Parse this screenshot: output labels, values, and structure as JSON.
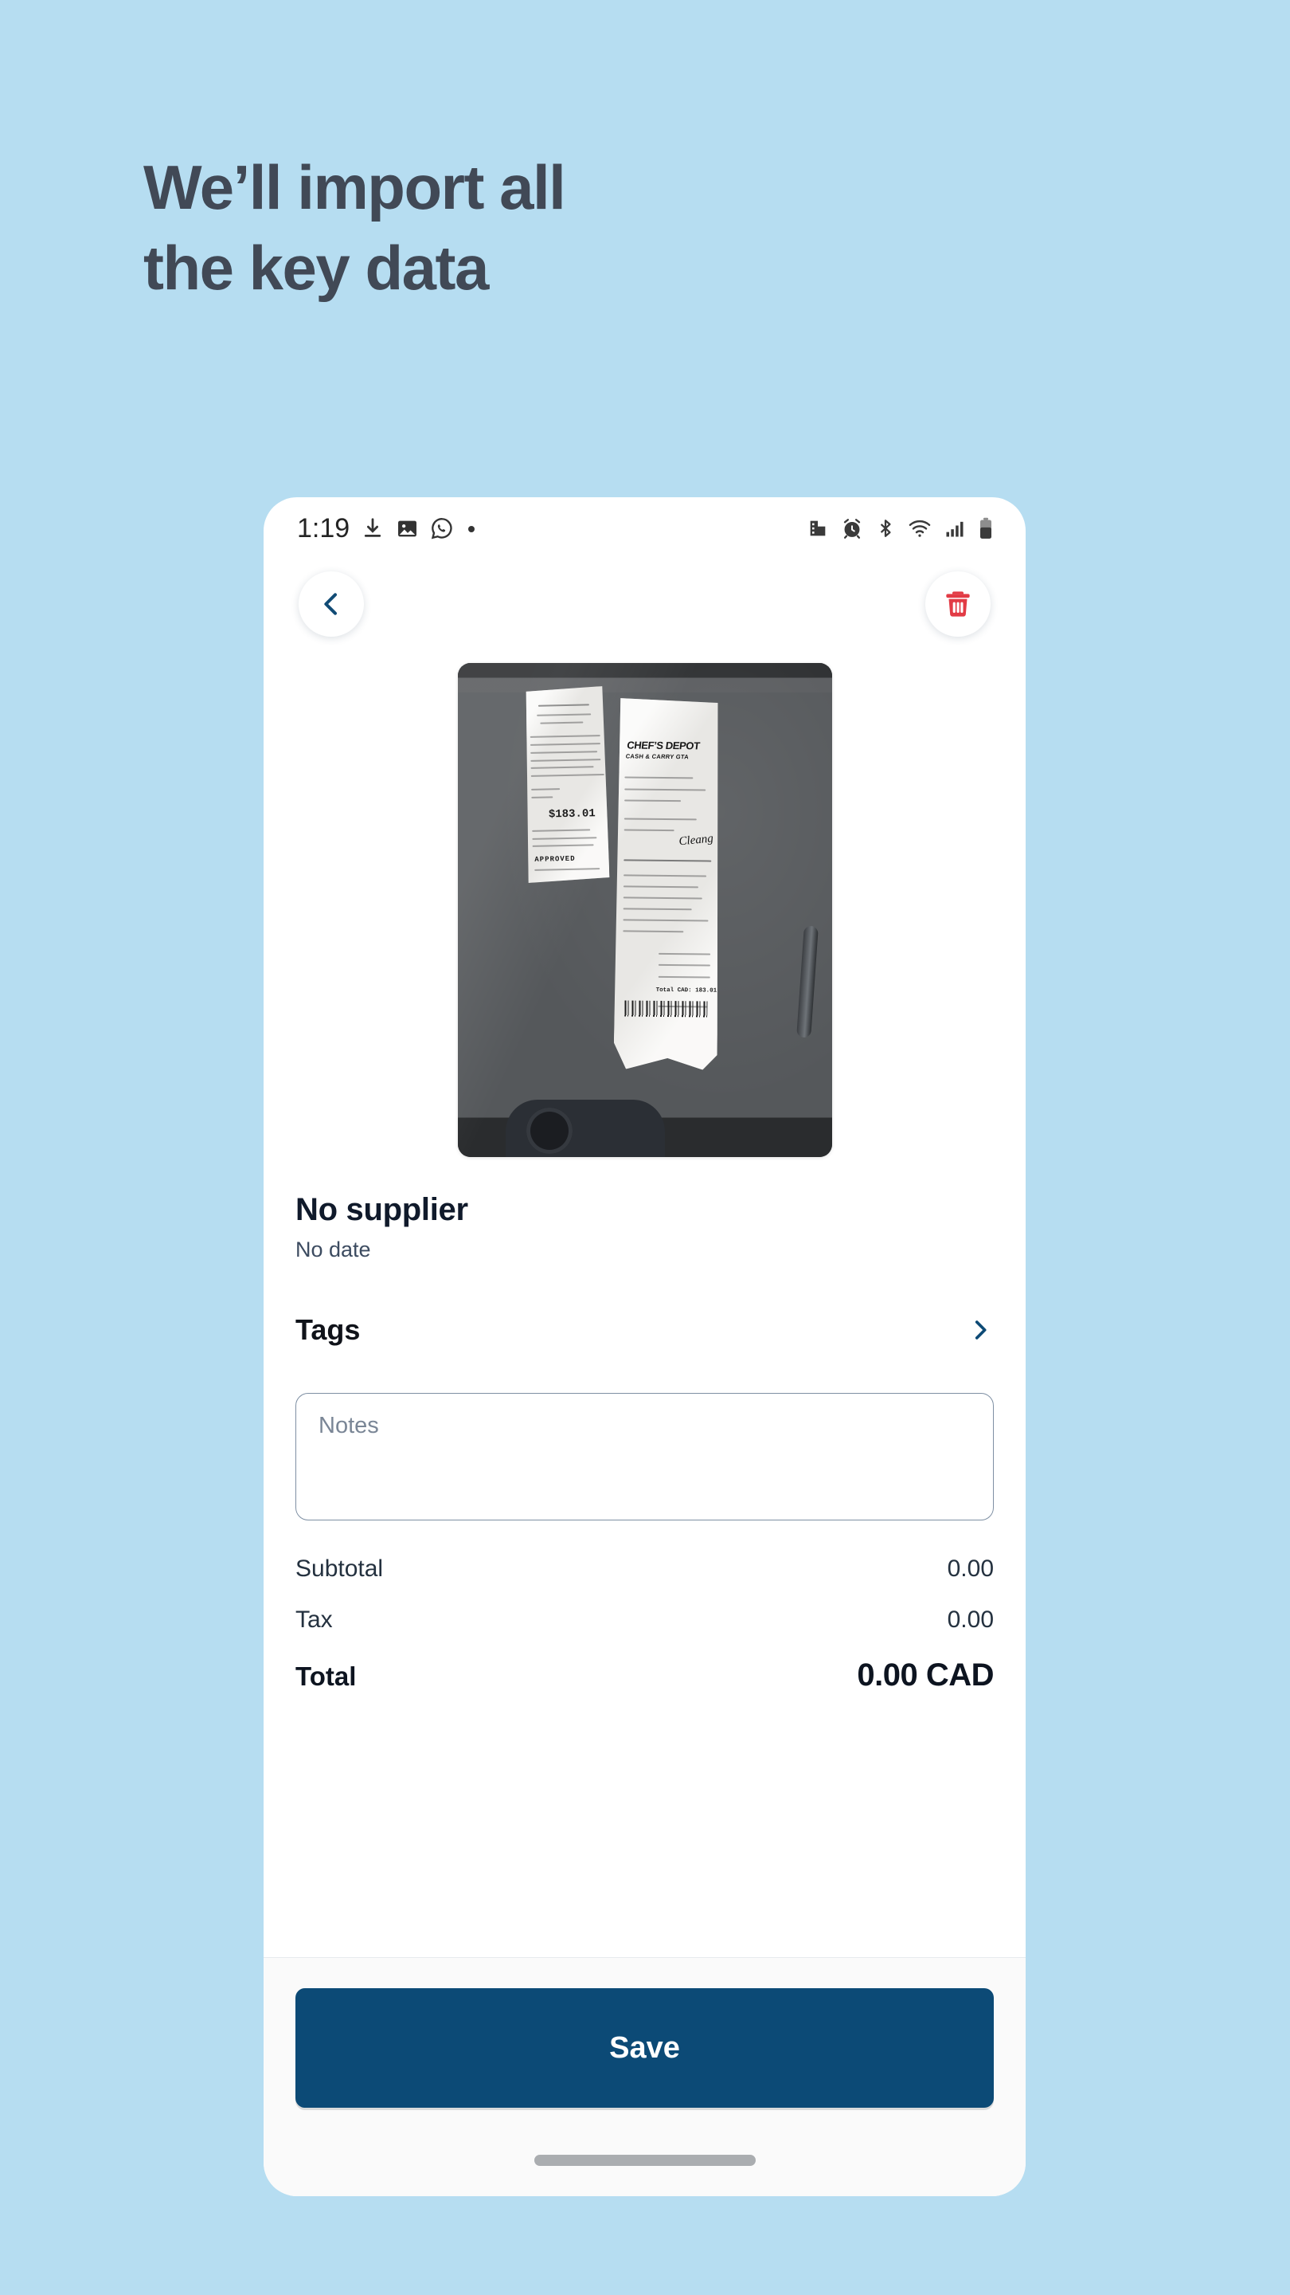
{
  "page": {
    "background_color": "#b6ddf1",
    "headline_color": "#414956",
    "headline_line1": "We’ll import all",
    "headline_line2": "the key data"
  },
  "phone": {
    "status_bar": {
      "time": "1:19",
      "left_icons": [
        "download-icon",
        "image-icon",
        "whatsapp-icon",
        "dot-icon"
      ],
      "right_icons": [
        "vibrate-icon",
        "alarm-icon",
        "bluetooth-icon",
        "wifi-icon",
        "signal-icon",
        "battery-icon"
      ]
    },
    "nav": {
      "back_label": "Back",
      "back_icon": "chevron-left-icon",
      "back_icon_color": "#114b75",
      "delete_label": "Delete",
      "delete_icon": "trash-icon",
      "delete_icon_color": "#e23b45"
    },
    "receipt_photo": {
      "alt": "Photo of two paper receipts on a dark grey table",
      "brand": "CHEF’S DEPOT",
      "brand_sub": "CASH & CARRY GTA",
      "card_slip_amount": "$183.01",
      "card_slip_status": "APPROVED",
      "signature_word": "Cleang"
    },
    "details": {
      "supplier": "No supplier",
      "date": "No date",
      "tags_label": "Tags",
      "tags_chevron_icon": "chevron-right-icon",
      "tags_chevron_color": "#0d4a75",
      "notes_placeholder": "Notes",
      "notes_value": ""
    },
    "totals": {
      "rows": [
        {
          "label": "Subtotal",
          "value": "0.00"
        },
        {
          "label": "Tax",
          "value": "0.00"
        }
      ],
      "total_label": "Total",
      "total_value": "0.00 CAD"
    },
    "footer": {
      "save_label": "Save",
      "save_button_color": "#0c4a76",
      "gesture_bar": "home-indicator"
    }
  }
}
